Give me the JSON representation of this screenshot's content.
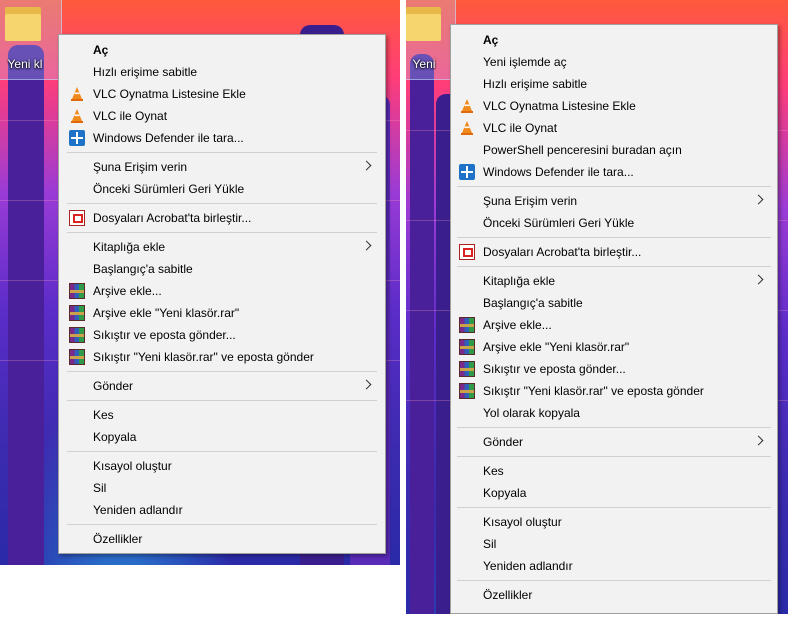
{
  "left": {
    "desktop_icon_label": "Yeni kl",
    "menu": [
      {
        "type": "item",
        "label": "Aç",
        "bold": true
      },
      {
        "type": "item",
        "label": "Hızlı erişime sabitle"
      },
      {
        "type": "item",
        "label": "VLC Oynatma Listesine Ekle",
        "icon": "vlc-icon"
      },
      {
        "type": "item",
        "label": "VLC ile Oynat",
        "icon": "vlc-icon"
      },
      {
        "type": "item",
        "label": "Windows Defender ile tara...",
        "icon": "defender-icon"
      },
      {
        "type": "sep"
      },
      {
        "type": "item",
        "label": "Şuna Erişim verin",
        "submenu": true
      },
      {
        "type": "item",
        "label": "Önceki Sürümleri Geri Yükle"
      },
      {
        "type": "sep"
      },
      {
        "type": "item",
        "label": "Dosyaları Acrobat'ta birleştir...",
        "icon": "acrobat-icon"
      },
      {
        "type": "sep"
      },
      {
        "type": "item",
        "label": "Kitaplığa ekle",
        "submenu": true
      },
      {
        "type": "item",
        "label": "Başlangıç'a sabitle"
      },
      {
        "type": "item",
        "label": "Arşive ekle...",
        "icon": "winrar-icon"
      },
      {
        "type": "item",
        "label": "Arşive ekle \"Yeni klasör.rar\"",
        "icon": "winrar-icon"
      },
      {
        "type": "item",
        "label": "Sıkıştır ve eposta gönder...",
        "icon": "winrar-icon"
      },
      {
        "type": "item",
        "label": "Sıkıştır \"Yeni klasör.rar\" ve eposta gönder",
        "icon": "winrar-icon"
      },
      {
        "type": "sep"
      },
      {
        "type": "item",
        "label": "Gönder",
        "submenu": true
      },
      {
        "type": "sep"
      },
      {
        "type": "item",
        "label": "Kes"
      },
      {
        "type": "item",
        "label": "Kopyala"
      },
      {
        "type": "sep"
      },
      {
        "type": "item",
        "label": "Kısayol oluştur"
      },
      {
        "type": "item",
        "label": "Sil"
      },
      {
        "type": "item",
        "label": "Yeniden adlandır"
      },
      {
        "type": "sep"
      },
      {
        "type": "item",
        "label": "Özellikler"
      }
    ]
  },
  "right": {
    "desktop_icon_label": "Yeni",
    "menu": [
      {
        "type": "item",
        "label": "Aç",
        "bold": true
      },
      {
        "type": "item",
        "label": "Yeni işlemde aç"
      },
      {
        "type": "item",
        "label": "Hızlı erişime sabitle"
      },
      {
        "type": "item",
        "label": "VLC Oynatma Listesine Ekle",
        "icon": "vlc-icon"
      },
      {
        "type": "item",
        "label": "VLC ile Oynat",
        "icon": "vlc-icon"
      },
      {
        "type": "item",
        "label": "PowerShell penceresini buradan açın"
      },
      {
        "type": "item",
        "label": "Windows Defender ile tara...",
        "icon": "defender-icon"
      },
      {
        "type": "sep"
      },
      {
        "type": "item",
        "label": "Şuna Erişim verin",
        "submenu": true
      },
      {
        "type": "item",
        "label": "Önceki Sürümleri Geri Yükle"
      },
      {
        "type": "sep"
      },
      {
        "type": "item",
        "label": "Dosyaları Acrobat'ta birleştir...",
        "icon": "acrobat-icon"
      },
      {
        "type": "sep"
      },
      {
        "type": "item",
        "label": "Kitaplığa ekle",
        "submenu": true
      },
      {
        "type": "item",
        "label": "Başlangıç'a sabitle"
      },
      {
        "type": "item",
        "label": "Arşive ekle...",
        "icon": "winrar-icon"
      },
      {
        "type": "item",
        "label": "Arşive ekle \"Yeni klasör.rar\"",
        "icon": "winrar-icon"
      },
      {
        "type": "item",
        "label": "Sıkıştır ve eposta gönder...",
        "icon": "winrar-icon"
      },
      {
        "type": "item",
        "label": "Sıkıştır \"Yeni klasör.rar\" ve eposta gönder",
        "icon": "winrar-icon"
      },
      {
        "type": "item",
        "label": "Yol olarak kopyala"
      },
      {
        "type": "sep"
      },
      {
        "type": "item",
        "label": "Gönder",
        "submenu": true
      },
      {
        "type": "sep"
      },
      {
        "type": "item",
        "label": "Kes"
      },
      {
        "type": "item",
        "label": "Kopyala"
      },
      {
        "type": "sep"
      },
      {
        "type": "item",
        "label": "Kısayol oluştur"
      },
      {
        "type": "item",
        "label": "Sil"
      },
      {
        "type": "item",
        "label": "Yeniden adlandır"
      },
      {
        "type": "sep"
      },
      {
        "type": "item",
        "label": "Özellikler"
      }
    ]
  }
}
